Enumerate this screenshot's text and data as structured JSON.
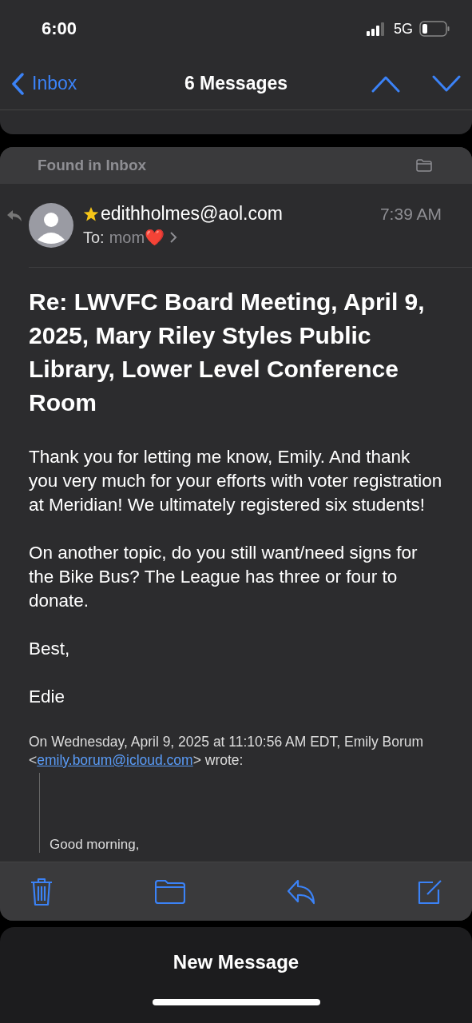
{
  "status_bar": {
    "time": "6:00",
    "network": "5G"
  },
  "nav": {
    "back": "Inbox",
    "title": "6 Messages"
  },
  "message": {
    "found_in": "Found in Inbox",
    "flagged": true,
    "from": "edithholmes@aol.com",
    "time": "7:39 AM",
    "to_label": "To:",
    "to_name": "mom",
    "to_emoji": "❤️",
    "subject": "Re: LWVFC Board Meeting, April 9, 2025, Mary Riley Styles Public Library, Lower Level Conference Room",
    "paragraphs": [
      "Thank you for letting me know, Emily. And thank you very much for your efforts with voter registration at Meridian! We ultimately registered six students!",
      "On another topic, do you still want/need signs for the Bike Bus? The League has three or four to donate.",
      "Best,",
      "Edie"
    ],
    "quote_header": {
      "before": "On Wednesday, April 9, 2025 at 11:10:56 AM EDT, Emily Borum <",
      "link": "emily.borum@icloud.com",
      "after": "> wrote:"
    },
    "quote": "Good morning,"
  },
  "sheet": {
    "title": "New Message"
  }
}
